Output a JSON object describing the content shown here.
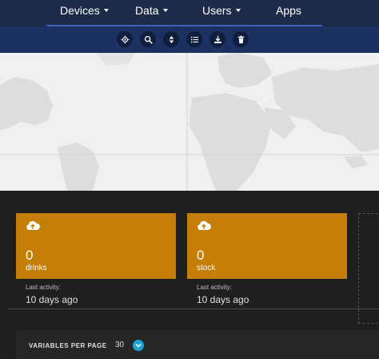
{
  "nav": {
    "items": [
      {
        "label": "Devices",
        "has_caret": true
      },
      {
        "label": "Data",
        "has_caret": true
      },
      {
        "label": "Users",
        "has_caret": true
      },
      {
        "label": "Apps",
        "has_caret": false
      }
    ]
  },
  "toolbar": {
    "icons": [
      "locate-icon",
      "search-icon",
      "sort-icon",
      "list-icon",
      "download-icon",
      "trash-icon"
    ]
  },
  "cards": [
    {
      "icon": "cloud-upload-icon",
      "value": "0",
      "label": "drinks",
      "last_activity_label": "Last activity:",
      "last_activity_value": "10 days ago"
    },
    {
      "icon": "cloud-upload-icon",
      "value": "0",
      "label": "stock",
      "last_activity_label": "Last activity:",
      "last_activity_value": "10 days ago"
    }
  ],
  "pagination": {
    "label": "VARIABLES PER PAGE",
    "value": "30"
  },
  "colors": {
    "nav_bg": "#1d2a4a",
    "toolbar_bg": "#1b3160",
    "card_accent": "#c47d05",
    "dropdown_accent": "#1ea3d6",
    "page_bg": "#1e1e1e"
  }
}
